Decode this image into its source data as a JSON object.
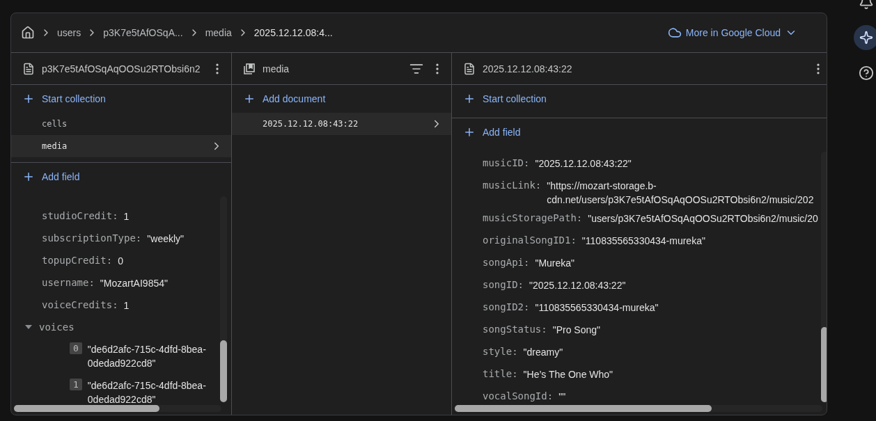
{
  "breadcrumb": [
    {
      "label": "users",
      "current": false
    },
    {
      "label": "p3K7e5tAfOSqA...",
      "current": false
    },
    {
      "label": "media",
      "current": false
    },
    {
      "label": "2025.12.12.08:4...",
      "current": true
    }
  ],
  "cloud_button": {
    "label": "More in Google Cloud"
  },
  "panels": [
    {
      "kind": "document",
      "title": "p3K7e5tAfOSqAqOOSu2RTObsi6n2",
      "action": "Start collection",
      "collections": [
        {
          "name": "cells",
          "selected": false
        },
        {
          "name": "media",
          "selected": true
        }
      ],
      "add_field": "Add field",
      "fields": [
        {
          "kind": "value",
          "key": "studioCredit:",
          "value": "1"
        },
        {
          "kind": "value",
          "key": "subscriptionType:",
          "value": "\"weekly\""
        },
        {
          "kind": "value",
          "key": "topupCredit:",
          "value": "0"
        },
        {
          "kind": "value",
          "key": "username:",
          "value": "\"MozartAI9854\""
        },
        {
          "kind": "value",
          "key": "voiceCredits:",
          "value": "1"
        },
        {
          "kind": "array",
          "key": "voices",
          "expanded": true,
          "items": [
            {
              "index": "0",
              "value": "\"de6d2afc-715c-4dfd-8bea-0dedad922cd8\""
            },
            {
              "index": "1",
              "value": "\"de6d2afc-715c-4dfd-8bea-0dedad922cd8\""
            }
          ]
        }
      ]
    },
    {
      "kind": "collection",
      "title": "media",
      "action": "Add document",
      "documents": [
        {
          "name": "2025.12.12.08:43:22",
          "selected": true
        }
      ]
    },
    {
      "kind": "document",
      "title": "2025.12.12.08:43:22",
      "action": "Start collection",
      "add_field": "Add field",
      "fields": [
        {
          "kind": "value",
          "key": "musicID:",
          "value": "\"2025.12.12.08:43:22\""
        },
        {
          "kind": "value",
          "key": "musicLink:",
          "value": "\"https://mozart-storage.b-cdn.net/users/p3K7e5tAfOSqAqOOSu2RTObsi6n2/music/202"
        },
        {
          "kind": "value",
          "key": "musicStoragePath:",
          "value": "\"users/p3K7e5tAfOSqAqOOSu2RTObsi6n2/music/20"
        },
        {
          "kind": "value",
          "key": "originalSongID1:",
          "value": "\"110835565330434-mureka\""
        },
        {
          "kind": "value",
          "key": "songApi:",
          "value": "\"Mureka\""
        },
        {
          "kind": "value",
          "key": "songID:",
          "value": "\"2025.12.12.08:43:22\""
        },
        {
          "kind": "value",
          "key": "songID2:",
          "value": "\"110835565330434-mureka\""
        },
        {
          "kind": "value",
          "key": "songStatus:",
          "value": "\"Pro Song\""
        },
        {
          "kind": "value",
          "key": "style:",
          "value": "\"dreamy\""
        },
        {
          "kind": "value",
          "key": "title:",
          "value": "\"He’s The One Who\""
        },
        {
          "kind": "value",
          "key": "vocalSongId:",
          "value": "\"\""
        }
      ]
    }
  ]
}
